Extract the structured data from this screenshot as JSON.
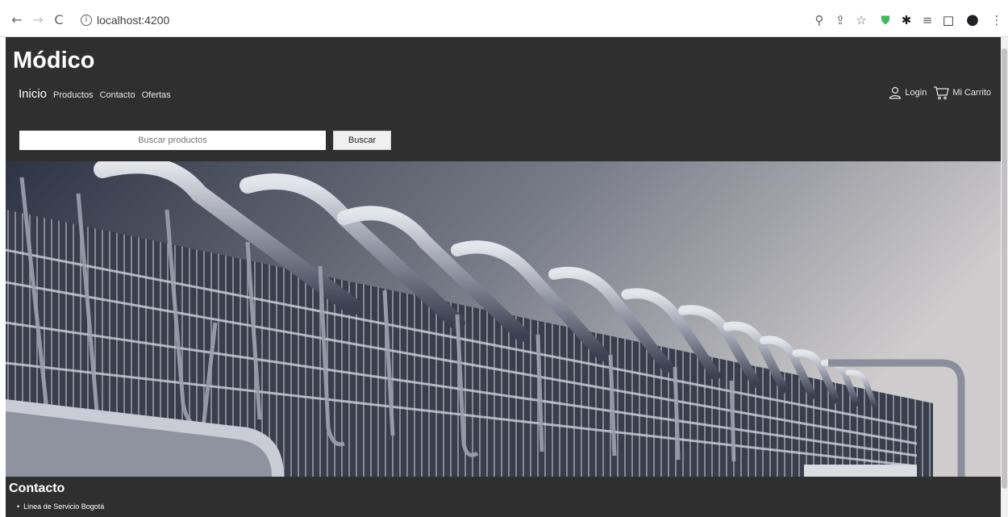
{
  "browser": {
    "url": "localhost:4200",
    "back_icon": "←",
    "forward_icon": "→",
    "reload_icon": "C",
    "info_icon": "i",
    "zoom_icon": "⚲",
    "share_icon": "⇪",
    "star_icon": "☆",
    "shield_icon": "⛊",
    "extensions_icon": "✱",
    "reading_list_icon": "≡",
    "sidepanel_icon": "□",
    "profile_icon": "●",
    "menu_icon": "⋮"
  },
  "header": {
    "brand": "Módico",
    "nav": [
      "Inicio",
      "Productos",
      "Contacto",
      "Ofertas"
    ],
    "login_label": "Login",
    "cart_label": "Mi Carrito"
  },
  "search": {
    "placeholder": "Buscar productos",
    "button_label": "Buscar"
  },
  "contact": {
    "title": "Contacto",
    "items": [
      "Linea de Servicio Bogotá"
    ]
  },
  "colors": {
    "page_bg": "#2f2f2f",
    "text": "#ffffff"
  }
}
